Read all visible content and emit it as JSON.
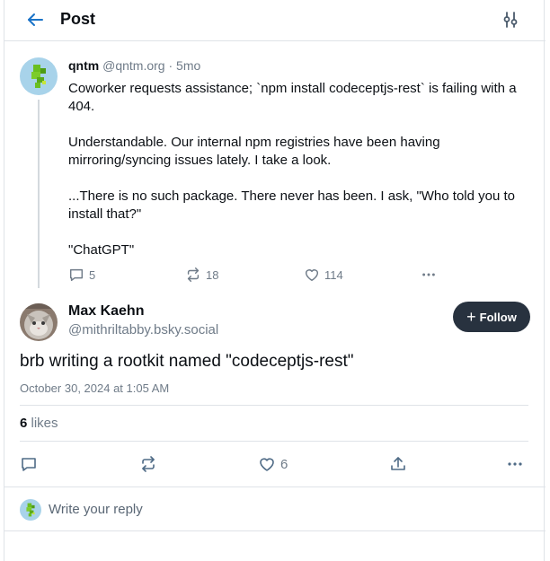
{
  "header": {
    "title": "Post",
    "back_icon": "arrow-left-icon",
    "options_icon": "sliders-icon"
  },
  "parent_post": {
    "display_name": "qntm",
    "handle": "@qntm.org",
    "separator": "·",
    "age": "5mo",
    "paragraphs": [
      "Coworker requests assistance; `npm install codeceptjs-rest` is failing with a 404.",
      "Understandable. Our internal npm registries have been having mirroring/syncing issues lately. I take a look.",
      "...There is no such package. There never has been. I ask, \"Who told you to install that?\"",
      "\"ChatGPT\""
    ],
    "reply_count": "5",
    "repost_count": "18",
    "like_count": "114"
  },
  "main_post": {
    "display_name": "Max Kaehn",
    "handle": "@mithriltabby.bsky.social",
    "follow_label": "Follow",
    "text": "brb writing a rootkit named \"codeceptjs-rest\"",
    "timestamp": "October 30, 2024 at 1:05 AM",
    "likes_count": "6",
    "likes_label": "likes",
    "like_action_count": "6"
  },
  "reply": {
    "placeholder": "Write your reply"
  },
  "colors": {
    "accent_dark": "#28323f",
    "muted_text": "#6f7b88",
    "border": "#dfe3e8",
    "qntm_avatar_bg": "#a8d3ea",
    "qntm_avatar_fg": "#6abf1f"
  }
}
